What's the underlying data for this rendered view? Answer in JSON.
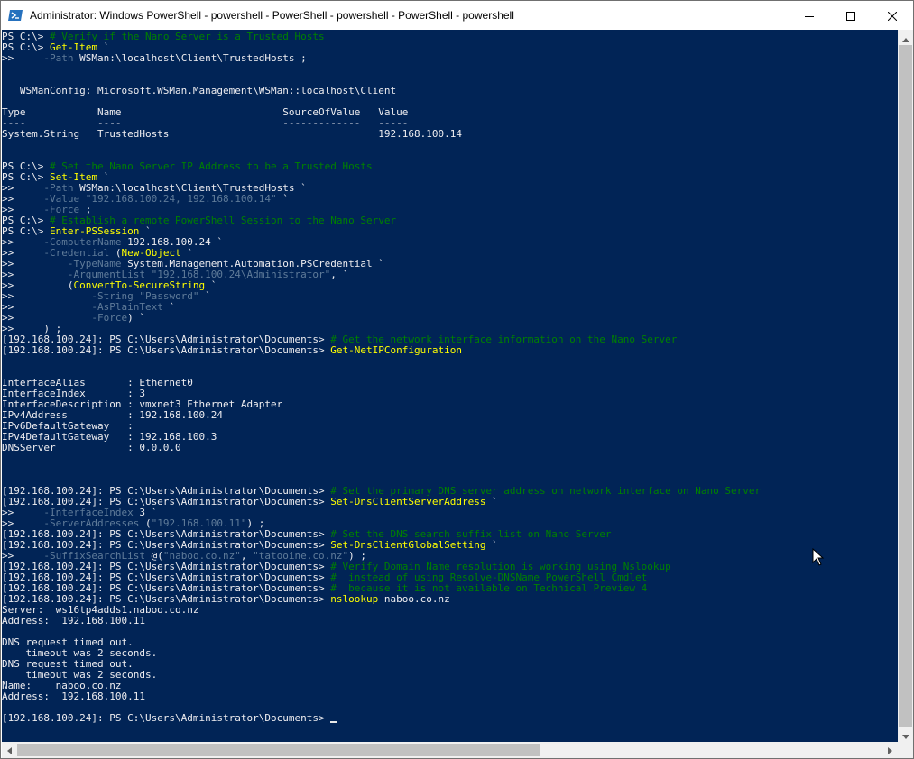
{
  "window": {
    "title": "Administrator: Windows PowerShell - powershell - PowerShell - powershell - PowerShell - powershell"
  },
  "icons": {
    "app": "powershell-icon",
    "minimize": "minimize-icon",
    "maximize": "maximize-icon",
    "close": "close-icon",
    "cursor": "mouse-cursor-icon"
  },
  "colors": {
    "console_bg": "#012456",
    "text": "#eeedf0",
    "command": "#ffff00",
    "comment": "#008000",
    "parameter": "#5f7b99"
  },
  "console": {
    "lines": [
      [
        {
          "t": "PS C:\\> ",
          "c": "w"
        },
        {
          "t": "# Verify if the Nano Server is a Trusted Hosts",
          "c": "g"
        }
      ],
      [
        {
          "t": "PS C:\\> ",
          "c": "w"
        },
        {
          "t": "Get-Item",
          "c": "y"
        },
        {
          "t": " `",
          "c": "w"
        }
      ],
      [
        {
          "t": ">>     ",
          "c": "w"
        },
        {
          "t": "-Path",
          "c": "s"
        },
        {
          "t": " WSMan:\\localhost\\Client\\TrustedHosts ;",
          "c": "w"
        }
      ],
      [],
      [],
      [
        {
          "t": "   WSManConfig: Microsoft.WSMan.Management\\WSMan::localhost\\Client",
          "c": "w"
        }
      ],
      [],
      [
        {
          "t": "Type            Name                           SourceOfValue   Value",
          "c": "w"
        }
      ],
      [
        {
          "t": "----            ----                           -------------   -----",
          "c": "w"
        }
      ],
      [
        {
          "t": "System.String   TrustedHosts                                   192.168.100.14",
          "c": "w"
        }
      ],
      [],
      [],
      [
        {
          "t": "PS C:\\> ",
          "c": "w"
        },
        {
          "t": "# Set the Nano Server IP Address to be a Trusted Hosts",
          "c": "g"
        }
      ],
      [
        {
          "t": "PS C:\\> ",
          "c": "w"
        },
        {
          "t": "Set-Item",
          "c": "y"
        },
        {
          "t": " `",
          "c": "w"
        }
      ],
      [
        {
          "t": ">>     ",
          "c": "w"
        },
        {
          "t": "-Path",
          "c": "s"
        },
        {
          "t": " WSMan:\\localhost\\Client\\TrustedHosts `",
          "c": "w"
        }
      ],
      [
        {
          "t": ">>     ",
          "c": "w"
        },
        {
          "t": "-Value",
          "c": "s"
        },
        {
          "t": " ",
          "c": "w"
        },
        {
          "t": "\"192.168.100.24, 192.168.100.14\"",
          "c": "c"
        },
        {
          "t": " `",
          "c": "w"
        }
      ],
      [
        {
          "t": ">>     ",
          "c": "w"
        },
        {
          "t": "-Force",
          "c": "s"
        },
        {
          "t": " ;",
          "c": "w"
        }
      ],
      [
        {
          "t": "PS C:\\> ",
          "c": "w"
        },
        {
          "t": "# Establish a remote PowerShell Session to the Nano Server",
          "c": "g"
        }
      ],
      [
        {
          "t": "PS C:\\> ",
          "c": "w"
        },
        {
          "t": "Enter-PSSession",
          "c": "y"
        },
        {
          "t": " `",
          "c": "w"
        }
      ],
      [
        {
          "t": ">>     ",
          "c": "w"
        },
        {
          "t": "-ComputerName",
          "c": "s"
        },
        {
          "t": " 192.168.100.24 `",
          "c": "w"
        }
      ],
      [
        {
          "t": ">>     ",
          "c": "w"
        },
        {
          "t": "-Credential",
          "c": "s"
        },
        {
          "t": " (",
          "c": "w"
        },
        {
          "t": "New-Object",
          "c": "y"
        },
        {
          "t": " `",
          "c": "w"
        }
      ],
      [
        {
          "t": ">>         ",
          "c": "w"
        },
        {
          "t": "-TypeName",
          "c": "s"
        },
        {
          "t": " System.Management.Automation.PSCredential `",
          "c": "w"
        }
      ],
      [
        {
          "t": ">>         ",
          "c": "w"
        },
        {
          "t": "-ArgumentList",
          "c": "s"
        },
        {
          "t": " ",
          "c": "w"
        },
        {
          "t": "\"192.168.100.24\\Administrator\"",
          "c": "c"
        },
        {
          "t": ", `",
          "c": "w"
        }
      ],
      [
        {
          "t": ">>         (",
          "c": "w"
        },
        {
          "t": "ConvertTo-SecureString",
          "c": "y"
        },
        {
          "t": " `",
          "c": "w"
        }
      ],
      [
        {
          "t": ">>             ",
          "c": "w"
        },
        {
          "t": "-String",
          "c": "s"
        },
        {
          "t": " ",
          "c": "w"
        },
        {
          "t": "\"Password\"",
          "c": "c"
        },
        {
          "t": " `",
          "c": "w"
        }
      ],
      [
        {
          "t": ">>             ",
          "c": "w"
        },
        {
          "t": "-AsPlainText",
          "c": "s"
        },
        {
          "t": " `",
          "c": "w"
        }
      ],
      [
        {
          "t": ">>             ",
          "c": "w"
        },
        {
          "t": "-Force",
          "c": "s"
        },
        {
          "t": ") `",
          "c": "w"
        }
      ],
      [
        {
          "t": ">>     ) ;",
          "c": "w"
        }
      ],
      [
        {
          "t": "[192.168.100.24]: PS C:\\Users\\Administrator\\Documents> ",
          "c": "w"
        },
        {
          "t": "# Get the network interface information on the Nano Server",
          "c": "g"
        }
      ],
      [
        {
          "t": "[192.168.100.24]: PS C:\\Users\\Administrator\\Documents> ",
          "c": "w"
        },
        {
          "t": "Get-NetIPConfiguration",
          "c": "y"
        }
      ],
      [],
      [],
      [
        {
          "t": "InterfaceAlias       : Ethernet0",
          "c": "w"
        }
      ],
      [
        {
          "t": "InterfaceIndex       : 3",
          "c": "w"
        }
      ],
      [
        {
          "t": "InterfaceDescription : vmxnet3 Ethernet Adapter",
          "c": "w"
        }
      ],
      [
        {
          "t": "IPv4Address          : 192.168.100.24",
          "c": "w"
        }
      ],
      [
        {
          "t": "IPv6DefaultGateway   :",
          "c": "w"
        }
      ],
      [
        {
          "t": "IPv4DefaultGateway   : 192.168.100.3",
          "c": "w"
        }
      ],
      [
        {
          "t": "DNSServer            : 0.0.0.0",
          "c": "w"
        }
      ],
      [],
      [],
      [],
      [
        {
          "t": "[192.168.100.24]: PS C:\\Users\\Administrator\\Documents> ",
          "c": "w"
        },
        {
          "t": "# Set the primary DNS server address on network interface on Nano Server",
          "c": "g"
        }
      ],
      [
        {
          "t": "[192.168.100.24]: PS C:\\Users\\Administrator\\Documents> ",
          "c": "w"
        },
        {
          "t": "Set-DnsClientServerAddress",
          "c": "y"
        },
        {
          "t": " `",
          "c": "w"
        }
      ],
      [
        {
          "t": ">>     ",
          "c": "w"
        },
        {
          "t": "-InterfaceIndex",
          "c": "s"
        },
        {
          "t": " 3 `",
          "c": "w"
        }
      ],
      [
        {
          "t": ">>     ",
          "c": "w"
        },
        {
          "t": "-ServerAddresses",
          "c": "s"
        },
        {
          "t": " (",
          "c": "w"
        },
        {
          "t": "\"192.168.100.11\"",
          "c": "c"
        },
        {
          "t": ") ;",
          "c": "w"
        }
      ],
      [
        {
          "t": "[192.168.100.24]: PS C:\\Users\\Administrator\\Documents> ",
          "c": "w"
        },
        {
          "t": "# Set the DNS search suffix list on Nano Server",
          "c": "g"
        }
      ],
      [
        {
          "t": "[192.168.100.24]: PS C:\\Users\\Administrator\\Documents> ",
          "c": "w"
        },
        {
          "t": "Set-DnsClientGlobalSetting",
          "c": "y"
        },
        {
          "t": " `",
          "c": "w"
        }
      ],
      [
        {
          "t": ">>     ",
          "c": "w"
        },
        {
          "t": "-SuffixSearchList",
          "c": "s"
        },
        {
          "t": " @(",
          "c": "w"
        },
        {
          "t": "\"naboo.co.nz\"",
          "c": "c"
        },
        {
          "t": ", ",
          "c": "w"
        },
        {
          "t": "\"tatooine.co.nz\"",
          "c": "c"
        },
        {
          "t": ") ;",
          "c": "w"
        }
      ],
      [
        {
          "t": "[192.168.100.24]: PS C:\\Users\\Administrator\\Documents> ",
          "c": "w"
        },
        {
          "t": "# Verify Domain Name resolution is working using Nslookup",
          "c": "g"
        }
      ],
      [
        {
          "t": "[192.168.100.24]: PS C:\\Users\\Administrator\\Documents> ",
          "c": "w"
        },
        {
          "t": "#  instead of using Resolve-DNSName PowerShell Cmdlet",
          "c": "g"
        }
      ],
      [
        {
          "t": "[192.168.100.24]: PS C:\\Users\\Administrator\\Documents> ",
          "c": "w"
        },
        {
          "t": "#  because it is not available on Technical Preview 4",
          "c": "g"
        }
      ],
      [
        {
          "t": "[192.168.100.24]: PS C:\\Users\\Administrator\\Documents> ",
          "c": "w"
        },
        {
          "t": "nslookup",
          "c": "y"
        },
        {
          "t": " naboo.co.nz",
          "c": "w"
        }
      ],
      [
        {
          "t": "Server:  ws16tp4adds1.naboo.co.nz",
          "c": "w"
        }
      ],
      [
        {
          "t": "Address:  192.168.100.11",
          "c": "w"
        }
      ],
      [],
      [
        {
          "t": "DNS request timed out.",
          "c": "w"
        }
      ],
      [
        {
          "t": "    timeout was 2 seconds.",
          "c": "w"
        }
      ],
      [
        {
          "t": "DNS request timed out.",
          "c": "w"
        }
      ],
      [
        {
          "t": "    timeout was 2 seconds.",
          "c": "w"
        }
      ],
      [
        {
          "t": "Name:    naboo.co.nz",
          "c": "w"
        }
      ],
      [
        {
          "t": "Address:  192.168.100.11",
          "c": "w"
        }
      ],
      [],
      [
        {
          "t": "[192.168.100.24]: PS C:\\Users\\Administrator\\Documents> ",
          "c": "w"
        }
      ]
    ]
  }
}
